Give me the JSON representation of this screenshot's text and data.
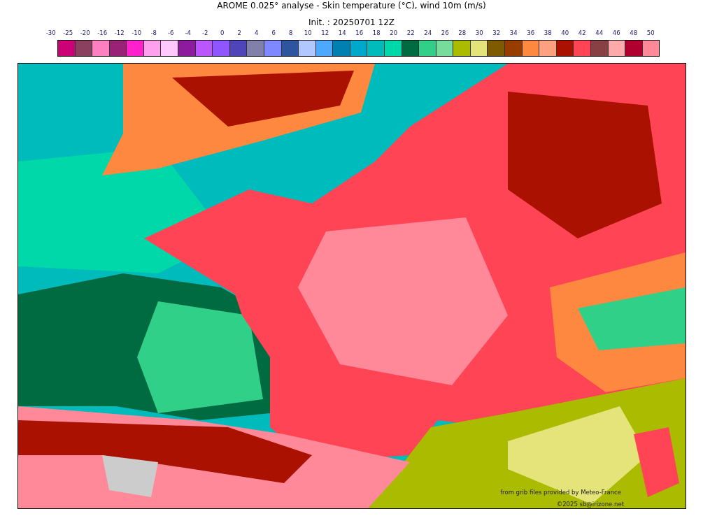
{
  "title": "AROME 0.025° analyse - Skin temperature (°C), wind 10m (m/s)",
  "subtitle": "Init. : 20250701 12Z",
  "colorbar": {
    "ticks": [
      "-30",
      "-25",
      "-20",
      "-16",
      "-12",
      "-10",
      "-8",
      "-6",
      "-4",
      "-2",
      "0",
      "2",
      "4",
      "6",
      "8",
      "10",
      "12",
      "14",
      "16",
      "18",
      "20",
      "22",
      "24",
      "26",
      "28",
      "30",
      "32",
      "34",
      "36",
      "38",
      "40",
      "42",
      "44",
      "46",
      "48",
      "50"
    ],
    "swatches": [
      {
        "color": "#cc0077"
      },
      {
        "color": "#8b4060"
      },
      {
        "color": "#ff80c0"
      },
      {
        "color": "#992277"
      },
      {
        "color": "#ff22cc"
      },
      {
        "color": "#ffa0ee"
      },
      {
        "color": "#ffc8ff"
      },
      {
        "color": "#8e1a9e"
      },
      {
        "color": "#bb55ff"
      },
      {
        "color": "#8f55ff"
      },
      {
        "color": "#5044bb"
      },
      {
        "color": "#8080aa"
      },
      {
        "color": "#8088ff"
      },
      {
        "color": "#2e55a0"
      },
      {
        "color": "#b0c8ff"
      },
      {
        "color": "#4da8ff"
      },
      {
        "color": "#0080b0"
      },
      {
        "color": "#00a8cc"
      },
      {
        "color": "#00bbbb"
      },
      {
        "color": "#00d8aa"
      },
      {
        "color": "#006a40"
      },
      {
        "color": "#30d088"
      },
      {
        "color": "#77dd9d"
      },
      {
        "color": "#aabb00"
      },
      {
        "color": "#e4e47a"
      },
      {
        "color": "#805a00"
      },
      {
        "color": "#993c00"
      },
      {
        "color": "#ff8840"
      },
      {
        "color": "#ffa080"
      },
      {
        "color": "#aa1100"
      },
      {
        "color": "#ff4455"
      },
      {
        "color": "#884044"
      },
      {
        "color": "#ffaaaa"
      },
      {
        "color": "#b00030"
      },
      {
        "color": "#ff8899"
      }
    ]
  },
  "map": {
    "credit": "from grib files provided by Meteo-France",
    "copyright": "©2025 sb@irizone.net"
  }
}
